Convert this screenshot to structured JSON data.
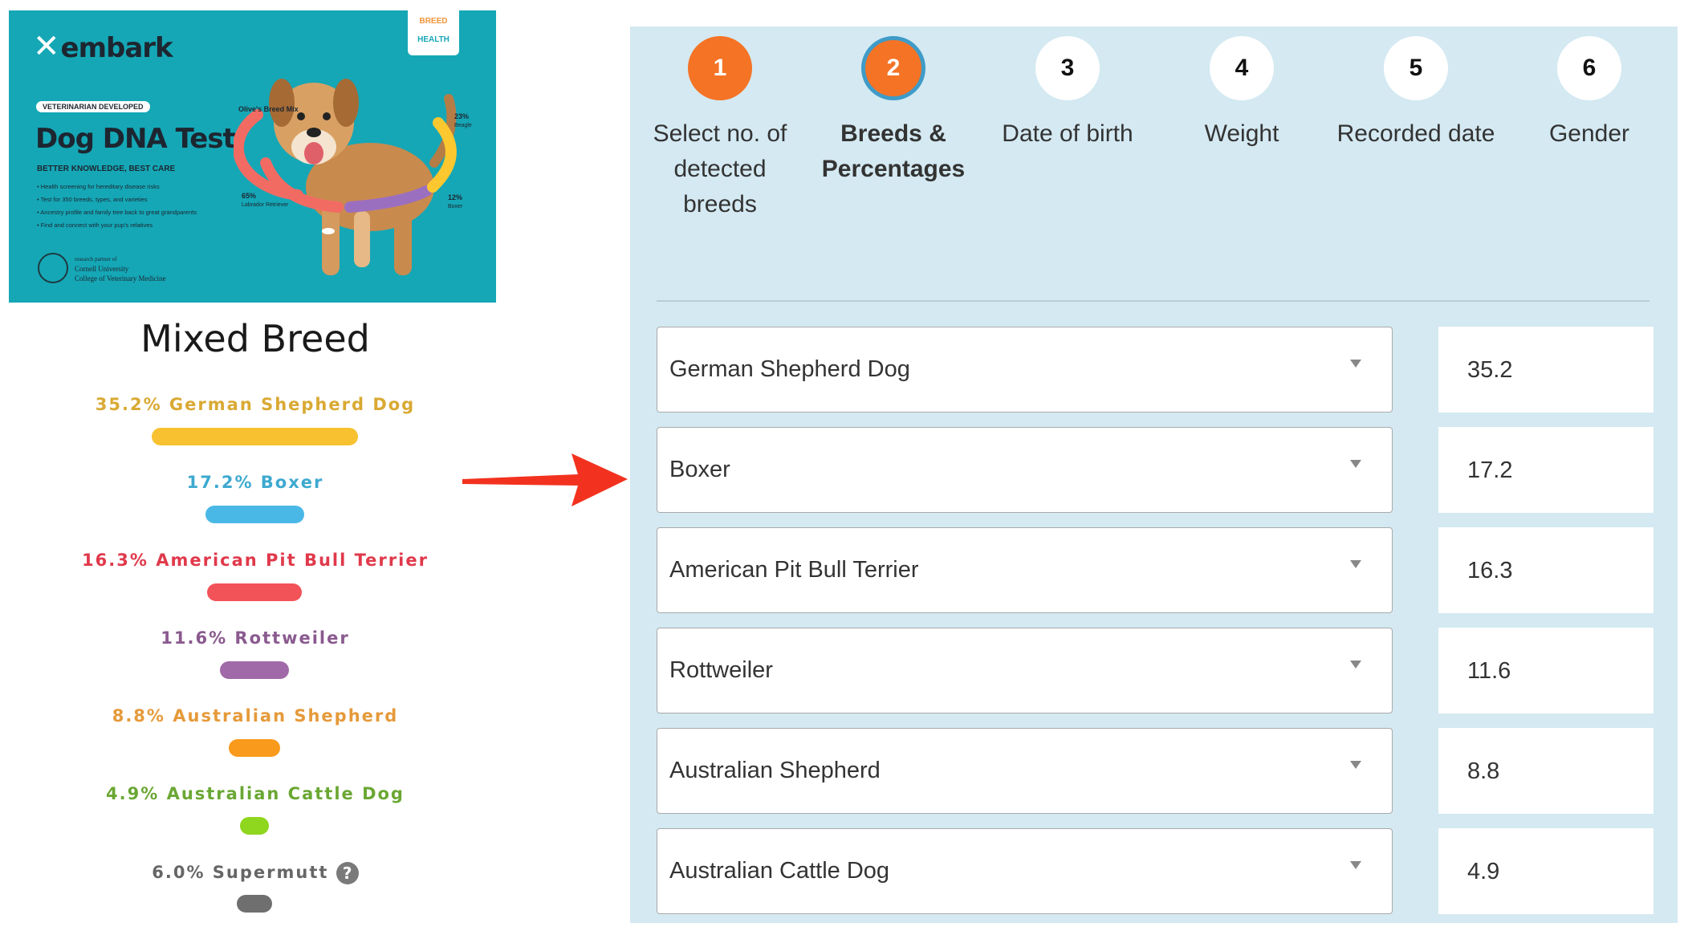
{
  "product": {
    "brand": "embark",
    "badge_top": "BREED",
    "badge_bottom": "HEALTH",
    "pill": "VETERINARIAN DEVELOPED",
    "title": "Dog DNA Test",
    "tagline": "BETTER KNOWLEDGE, BEST CARE",
    "bullets": [
      "Health screening for hereditary disease risks",
      "Test for 350 breeds, types, and varieties",
      "Ancestry profile and family tree back to great grandparents",
      "Find and connect with your pup's relatives"
    ],
    "partner_line1": "research partner of",
    "partner_line2": "Cornell University",
    "partner_line3": "College of Veterinary Medicine",
    "mix_label": "Olive's Breed Mix",
    "mix": [
      {
        "pct": "65%",
        "breed": "Labrador Retriever",
        "color": "#f26b63"
      },
      {
        "pct": "23%",
        "breed": "Beagle",
        "color": "#fdc82f"
      },
      {
        "pct": "12%",
        "breed": "Boxer",
        "color": "#9b6fc0"
      }
    ]
  },
  "legend": {
    "title": "Mixed Breed",
    "items": [
      {
        "label": "35.2% German Shepherd Dog",
        "value": 35.2,
        "color": "#f7c130",
        "text_color": "#d9a933"
      },
      {
        "label": "17.2% Boxer",
        "value": 17.2,
        "color": "#4ab8e6",
        "text_color": "#3da9cf"
      },
      {
        "label": "16.3% American Pit Bull Terrier",
        "value": 16.3,
        "color": "#f25358",
        "text_color": "#e0394b"
      },
      {
        "label": "11.6% Rottweiler",
        "value": 11.6,
        "color": "#a06aa8",
        "text_color": "#8a5a8f"
      },
      {
        "label": "8.8% Australian Shepherd",
        "value": 8.8,
        "color": "#f99a1c",
        "text_color": "#e59a3a"
      },
      {
        "label": "4.9% Australian Cattle Dog",
        "value": 4.9,
        "color": "#8fd61f",
        "text_color": "#6aa733"
      },
      {
        "label": "6.0% Supermutt",
        "value": 6.0,
        "color": "#6f6f6f",
        "text_color": "#666666",
        "help": "?"
      }
    ]
  },
  "wizard": {
    "steps": [
      {
        "number": "1",
        "label": "Select no. of detected breeds",
        "state": "done"
      },
      {
        "number": "2",
        "label": "Breeds & Percentages",
        "state": "active"
      },
      {
        "number": "3",
        "label": "Date of birth",
        "state": "todo"
      },
      {
        "number": "4",
        "label": "Weight",
        "state": "todo"
      },
      {
        "number": "5",
        "label": "Recorded date",
        "state": "todo"
      },
      {
        "number": "6",
        "label": "Gender",
        "state": "todo"
      }
    ],
    "rows": [
      {
        "breed": "German Shepherd Dog",
        "percent": "35.2"
      },
      {
        "breed": "Boxer",
        "percent": "17.2"
      },
      {
        "breed": "American Pit Bull Terrier",
        "percent": "16.3"
      },
      {
        "breed": "Rottweiler",
        "percent": "11.6"
      },
      {
        "breed": "Australian Shepherd",
        "percent": "8.8"
      },
      {
        "breed": "Australian Cattle Dog",
        "percent": "4.9"
      }
    ]
  },
  "colors": {
    "accent": "#f47325",
    "active_ring": "#3f9bc7",
    "panel_bg": "#d4e9f2",
    "arrow": "#f2321f"
  }
}
